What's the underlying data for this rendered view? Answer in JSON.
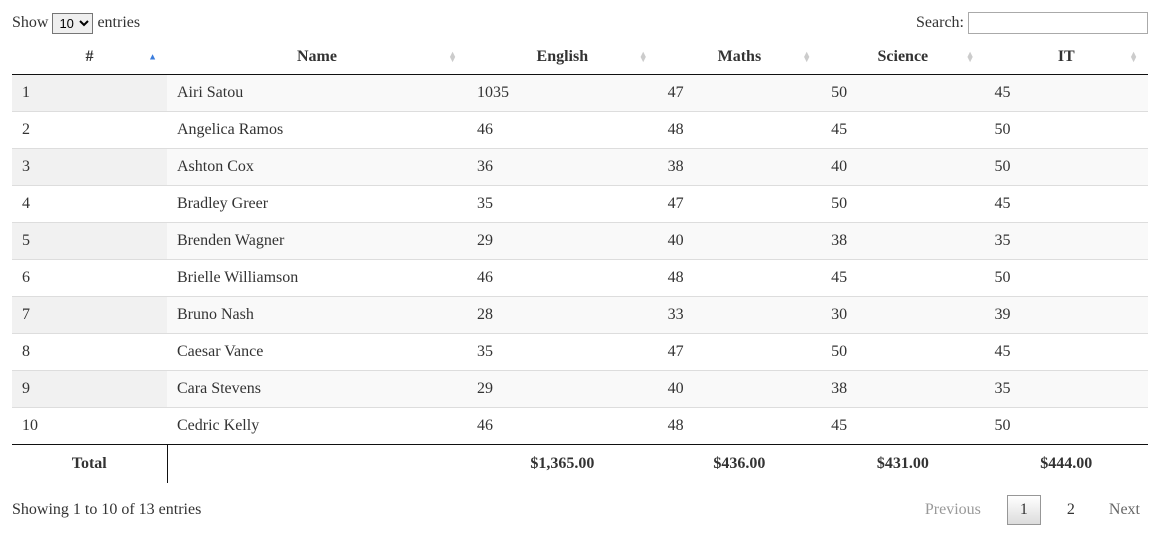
{
  "length_menu": {
    "pre": "Show",
    "post": "entries",
    "value": "10"
  },
  "search": {
    "label": "Search:",
    "value": ""
  },
  "columns": [
    {
      "key": "idx",
      "label": "#",
      "sort": "asc"
    },
    {
      "key": "name",
      "label": "Name",
      "sort": "both"
    },
    {
      "key": "english",
      "label": "English",
      "sort": "both"
    },
    {
      "key": "maths",
      "label": "Maths",
      "sort": "both"
    },
    {
      "key": "science",
      "label": "Science",
      "sort": "both"
    },
    {
      "key": "it",
      "label": "IT",
      "sort": "both"
    }
  ],
  "rows": [
    {
      "idx": "1",
      "name": "Airi Satou",
      "english": "1035",
      "maths": "47",
      "science": "50",
      "it": "45"
    },
    {
      "idx": "2",
      "name": "Angelica Ramos",
      "english": "46",
      "maths": "48",
      "science": "45",
      "it": "50"
    },
    {
      "idx": "3",
      "name": "Ashton Cox",
      "english": "36",
      "maths": "38",
      "science": "40",
      "it": "50"
    },
    {
      "idx": "4",
      "name": "Bradley Greer",
      "english": "35",
      "maths": "47",
      "science": "50",
      "it": "45"
    },
    {
      "idx": "5",
      "name": "Brenden Wagner",
      "english": "29",
      "maths": "40",
      "science": "38",
      "it": "35"
    },
    {
      "idx": "6",
      "name": "Brielle Williamson",
      "english": "46",
      "maths": "48",
      "science": "45",
      "it": "50"
    },
    {
      "idx": "7",
      "name": "Bruno Nash",
      "english": "28",
      "maths": "33",
      "science": "30",
      "it": "39"
    },
    {
      "idx": "8",
      "name": "Caesar Vance",
      "english": "35",
      "maths": "47",
      "science": "50",
      "it": "45"
    },
    {
      "idx": "9",
      "name": "Cara Stevens",
      "english": "29",
      "maths": "40",
      "science": "38",
      "it": "35"
    },
    {
      "idx": "10",
      "name": "Cedric Kelly",
      "english": "46",
      "maths": "48",
      "science": "45",
      "it": "50"
    }
  ],
  "footer": {
    "label": "Total",
    "english": "$1,365.00",
    "maths": "$436.00",
    "science": "$431.00",
    "it": "$444.00"
  },
  "info": "Showing 1 to 10 of 13 entries",
  "pagination": {
    "previous": "Previous",
    "next": "Next",
    "pages": [
      "1",
      "2"
    ],
    "current": "1"
  }
}
